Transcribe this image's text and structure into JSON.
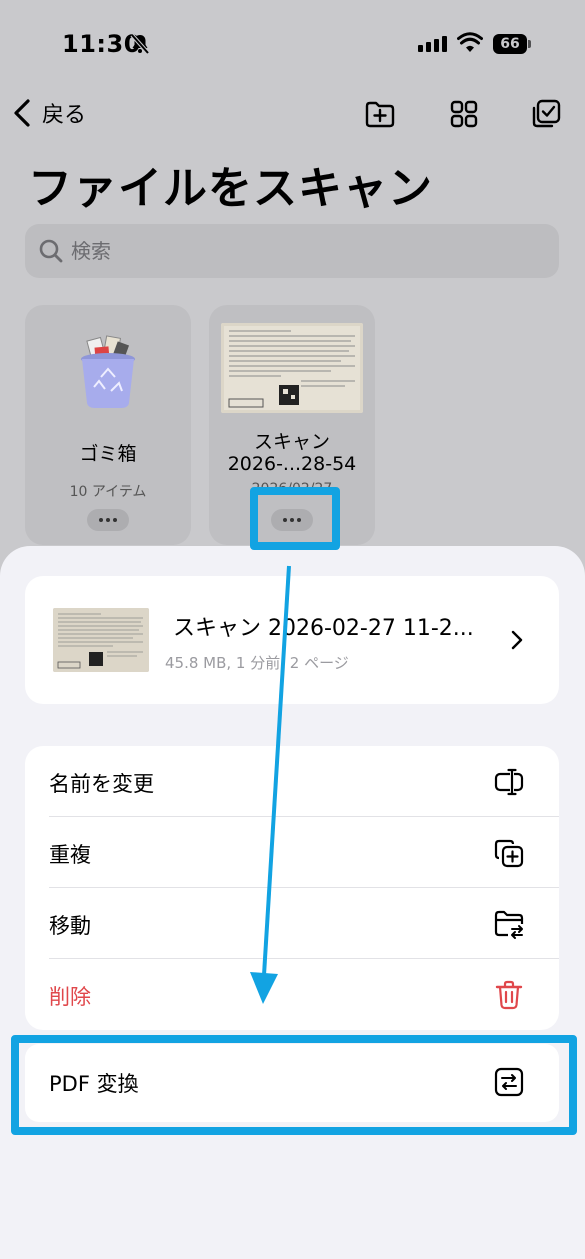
{
  "status_bar": {
    "time": "11:30",
    "battery": "66"
  },
  "nav": {
    "back_label": "戻る"
  },
  "page": {
    "title": "ファイルをスキャン"
  },
  "search": {
    "placeholder": "検索"
  },
  "files": [
    {
      "name": "ゴミ箱",
      "subtitle": "10 アイテム"
    },
    {
      "name_line1": "スキャン",
      "name_line2": "2026-...28-54",
      "subtitle": "2026/02/27"
    }
  ],
  "sheet": {
    "file": {
      "title": "スキャン 2026-02-27 11-2...",
      "meta": "45.8 MB, 1 分前, 2 ページ"
    },
    "menu": [
      {
        "label": "名前を変更",
        "icon": "rename-icon"
      },
      {
        "label": "重複",
        "icon": "duplicate-icon"
      },
      {
        "label": "移動",
        "icon": "move-folder-icon"
      },
      {
        "label": "削除",
        "icon": "trash-icon",
        "color": "#e0474b"
      }
    ],
    "pdf_convert": {
      "label": "PDF 変換",
      "icon": "convert-icon"
    }
  },
  "annotation_color": "#12a3e2"
}
